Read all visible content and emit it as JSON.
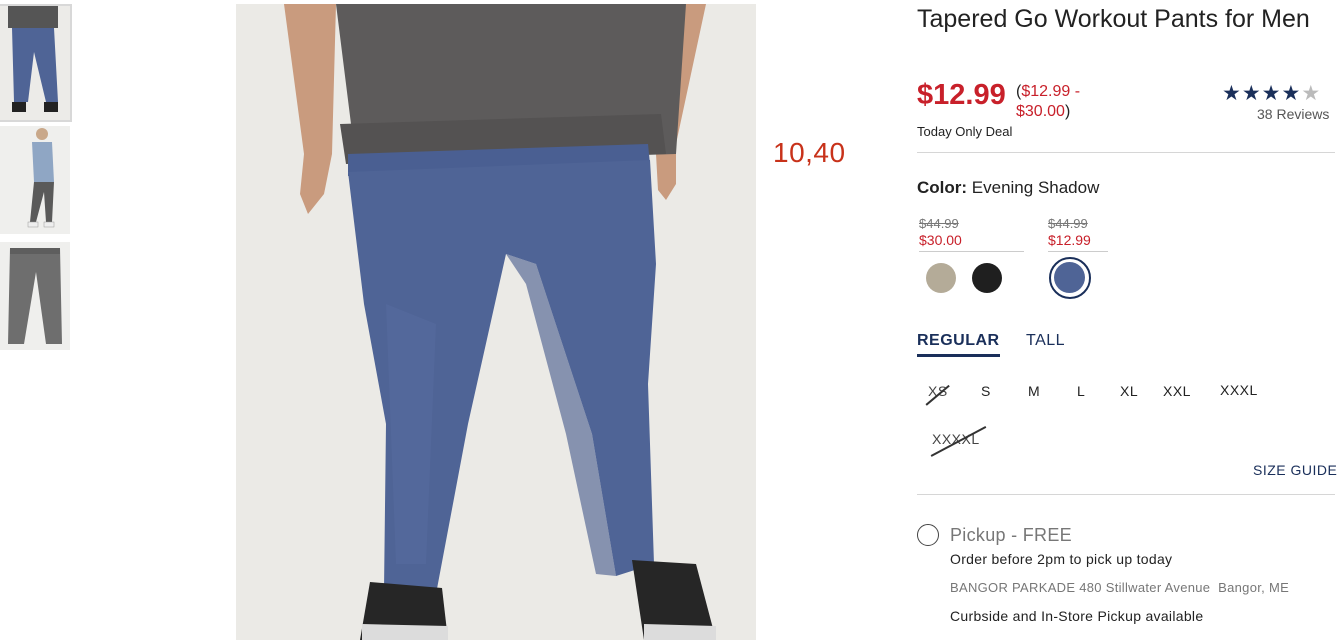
{
  "product": {
    "title": "Tapered Go Workout Pants for Men",
    "price_now": "$12.99",
    "price_range_open": "(",
    "price_range": "$12.99 - $30.00",
    "price_range_close": ")",
    "deal_label": "Today Only Deal",
    "rating": 4.5,
    "stars_full": "★★★★",
    "stars_half": "★",
    "reviews_label": "38 Reviews"
  },
  "overlay_number": "10,40",
  "color": {
    "label": "Color:",
    "value": "Evening Shadow",
    "groups": [
      {
        "old_price": "$44.99",
        "new_price": "$30.00",
        "swatches": [
          {
            "name": "khaki",
            "color": "#b4ab98"
          },
          {
            "name": "black",
            "color": "#1f1f1f"
          }
        ]
      },
      {
        "old_price": "$44.99",
        "new_price": "$12.99",
        "swatches": [
          {
            "name": "evening-shadow",
            "color": "#4f6496",
            "selected": true
          }
        ]
      }
    ]
  },
  "fit_tabs": {
    "regular": "REGULAR",
    "tall": "TALL",
    "active": "regular"
  },
  "sizes": [
    {
      "label": "XS",
      "available": false
    },
    {
      "label": "S",
      "available": true
    },
    {
      "label": "M",
      "available": true
    },
    {
      "label": "L",
      "available": true
    },
    {
      "label": "XL",
      "available": true
    },
    {
      "label": "XXL",
      "available": true
    },
    {
      "label": "XXXL",
      "available": true
    },
    {
      "label": "XXXXL",
      "available": false
    }
  ],
  "size_guide_label": "SIZE GUIDE",
  "pickup": {
    "label": "Pickup - FREE",
    "order_note": "Order before 2pm to pick up today",
    "store": "BANGOR PARKADE 480 Stillwater Avenue  Bangor, ME",
    "curbside": "Curbside and In-Store Pickup available"
  },
  "colors": {
    "sale_red": "#c8202a",
    "navy": "#1a2f5a",
    "pant_blue": "#4f6496"
  }
}
